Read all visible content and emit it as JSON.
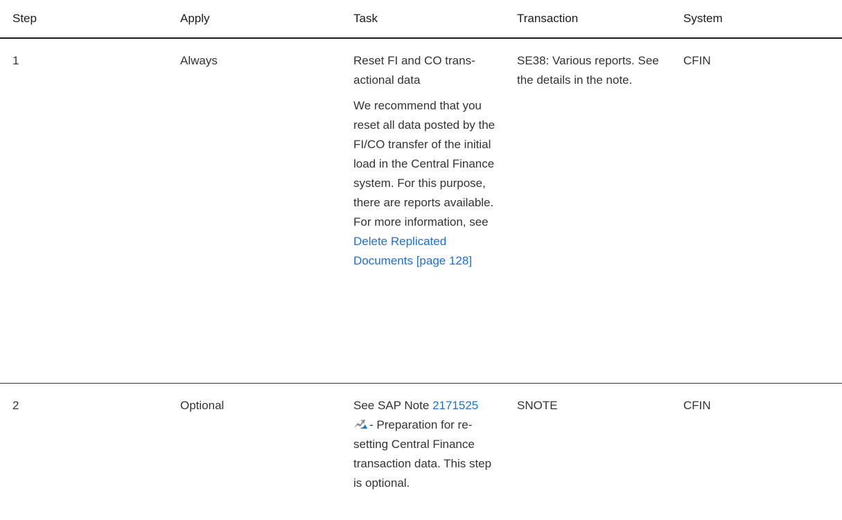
{
  "headers": {
    "step": "Step",
    "apply": "Apply",
    "task": "Task",
    "transaction": "Transaction",
    "system": "System"
  },
  "rows": [
    {
      "step": "1",
      "apply": "Always",
      "task_title": "Reset FI and CO trans­actional data",
      "task_body": "We recommend that you reset all data posted by the FI/CO transfer of the initial load in the Central Fi­nance system. For this purpose, there are re­ports available. For more information, see",
      "task_link": "Delete Replicated Documents [page 128]",
      "transaction": "SE38: Various reports. See the details in the note.",
      "system": "CFIN"
    },
    {
      "step": "2",
      "apply": "Optional",
      "task_prefix": "See SAP Note",
      "task_link": "2171525",
      "task_icon": "external-link-icon",
      "task_suffix": "- Preparation for re­setting Central Finance transaction data. This step is optional.",
      "transaction": "SNOTE",
      "system": "CFIN"
    }
  ],
  "colors": {
    "link": "#1f6fd6",
    "text": "#333333",
    "rule": "#1a1a1a"
  }
}
